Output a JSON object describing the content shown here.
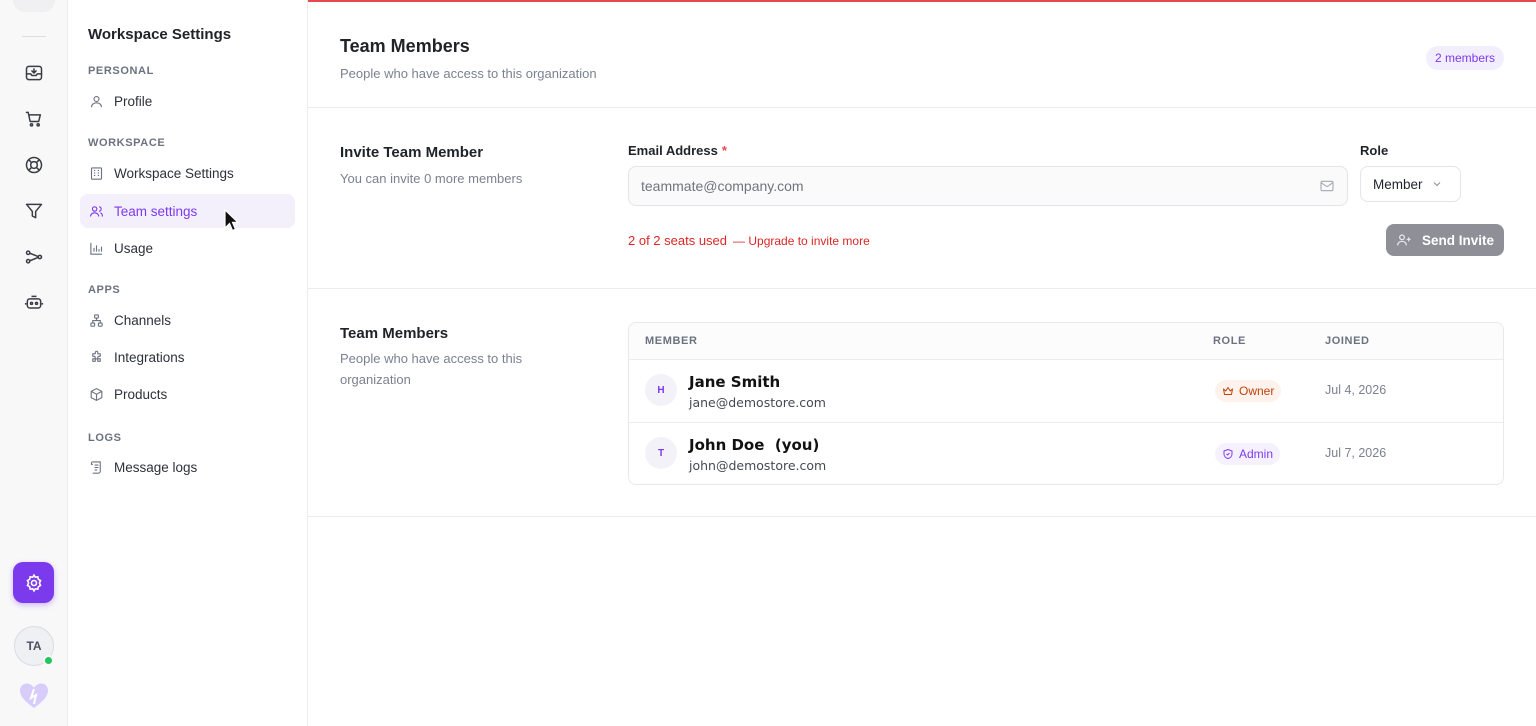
{
  "rail": {
    "icons": [
      "inbox-icon",
      "cart-icon",
      "help-circle-icon",
      "filter-icon",
      "flow-icon",
      "bot-icon"
    ],
    "avatar_initials": "TA",
    "colors": {
      "accent": "#7c3aed",
      "online": "#22c55e"
    }
  },
  "sidebar": {
    "title": "Workspace Settings",
    "sections": {
      "personal": "PERSONAL",
      "workspace": "WORKSPACE",
      "apps": "APPS",
      "logs": "LOGS"
    },
    "items": {
      "profile": "Profile",
      "workspace_settings": "Workspace Settings",
      "team_settings": "Team settings",
      "usage": "Usage",
      "channels": "Channels",
      "integrations": "Integrations",
      "products": "Products",
      "message_logs": "Message logs"
    },
    "active_item": "team_settings"
  },
  "header": {
    "title": "Team Members",
    "subtitle": "People who have access to this organization",
    "count_badge": "2 members"
  },
  "invite": {
    "title": "Invite Team Member",
    "subtitle": "You can invite 0 more members",
    "email_label": "Email Address",
    "required_mark": "*",
    "email_placeholder": "teammate@company.com",
    "email_value": "",
    "role_label": "Role",
    "role_value": "Member",
    "seats_text": "2 of 2 seats used",
    "upgrade_text": "— Upgrade to invite more",
    "send_button": "Send Invite"
  },
  "members": {
    "title": "Team Members",
    "subtitle": "People who have access to this organization",
    "columns": {
      "member": "MEMBER",
      "role": "ROLE",
      "joined": "JOINED"
    },
    "rows": [
      {
        "initial": "H",
        "name": "Jane Smith",
        "email": "jane@demostore.com",
        "role": "Owner",
        "role_icon": "crown-icon",
        "joined": "Jul 4, 2026"
      },
      {
        "initial": "T",
        "name": "John Doe  (you)",
        "email": "john@demostore.com",
        "role": "Admin",
        "role_icon": "shield-icon",
        "joined": "Jul 7, 2026"
      }
    ]
  }
}
